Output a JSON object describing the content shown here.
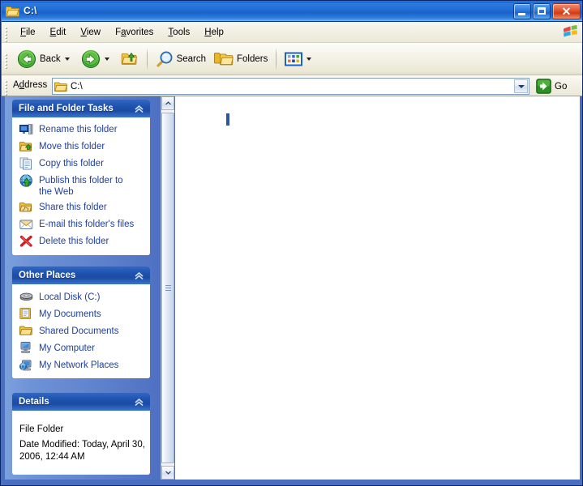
{
  "window": {
    "title": "C:\\",
    "title_icon": "folder-open-icon",
    "controls": {
      "minimize": "Minimize",
      "maximize": "Maximize",
      "close": "Close"
    }
  },
  "menubar": {
    "items": [
      {
        "label": "File",
        "accel": "F"
      },
      {
        "label": "Edit",
        "accel": "E"
      },
      {
        "label": "View",
        "accel": "V"
      },
      {
        "label": "Favorites",
        "accel": "a"
      },
      {
        "label": "Tools",
        "accel": "T"
      },
      {
        "label": "Help",
        "accel": "H"
      }
    ],
    "logo": "windows-flag-logo"
  },
  "toolbar": {
    "back_label": "Back",
    "back_icon": "back-arrow-icon",
    "forward_icon": "forward-arrow-icon",
    "up_icon": "up-folder-icon",
    "search_label": "Search",
    "search_icon": "search-icon",
    "folders_label": "Folders",
    "folders_icon": "folders-icon",
    "views_icon": "views-icon"
  },
  "address": {
    "label": "Address",
    "label_accel": "d",
    "value": "C:\\",
    "icon": "folder-icon",
    "dropdown_icon": "chevron-down-icon",
    "go_label": "Go",
    "go_icon": "go-arrow-icon"
  },
  "sidebar": {
    "panels": [
      {
        "title": "File and Folder Tasks",
        "collapse_icon": "chevron-up-icon",
        "items": [
          {
            "label": "Rename this folder",
            "icon": "rename-icon"
          },
          {
            "label": "Move this folder",
            "icon": "move-folder-icon"
          },
          {
            "label": "Copy this folder",
            "icon": "copy-icon"
          },
          {
            "label": "Publish this folder to the Web",
            "icon": "publish-web-icon"
          },
          {
            "label": "Share this folder",
            "icon": "share-folder-icon"
          },
          {
            "label": "E-mail this folder's files",
            "icon": "email-icon"
          },
          {
            "label": "Delete this folder",
            "icon": "delete-icon"
          }
        ]
      },
      {
        "title": "Other Places",
        "collapse_icon": "chevron-up-icon",
        "items": [
          {
            "label": "Local Disk (C:)",
            "icon": "hard-disk-icon"
          },
          {
            "label": "My Documents",
            "icon": "my-documents-icon"
          },
          {
            "label": "Shared Documents",
            "icon": "shared-documents-icon"
          },
          {
            "label": "My Computer",
            "icon": "my-computer-icon"
          },
          {
            "label": "My Network Places",
            "icon": "network-places-icon"
          }
        ]
      },
      {
        "title": "Details",
        "collapse_icon": "chevron-up-icon",
        "lines": [
          "File Folder",
          "Date Modified: Today, April 30, 2006, 12:44 AM"
        ]
      }
    ]
  },
  "filelist": {
    "items": [],
    "caret": "text-caret"
  },
  "colors": {
    "title_blue": "#1a62c8",
    "sidebar_blue": "#6e92d6",
    "panel_header_blue": "#1f52ae",
    "link_blue": "#1f3fa0",
    "close_red": "#cf3b17",
    "accent_green": "#2f9c28",
    "caret_blue": "#2c55a8"
  }
}
